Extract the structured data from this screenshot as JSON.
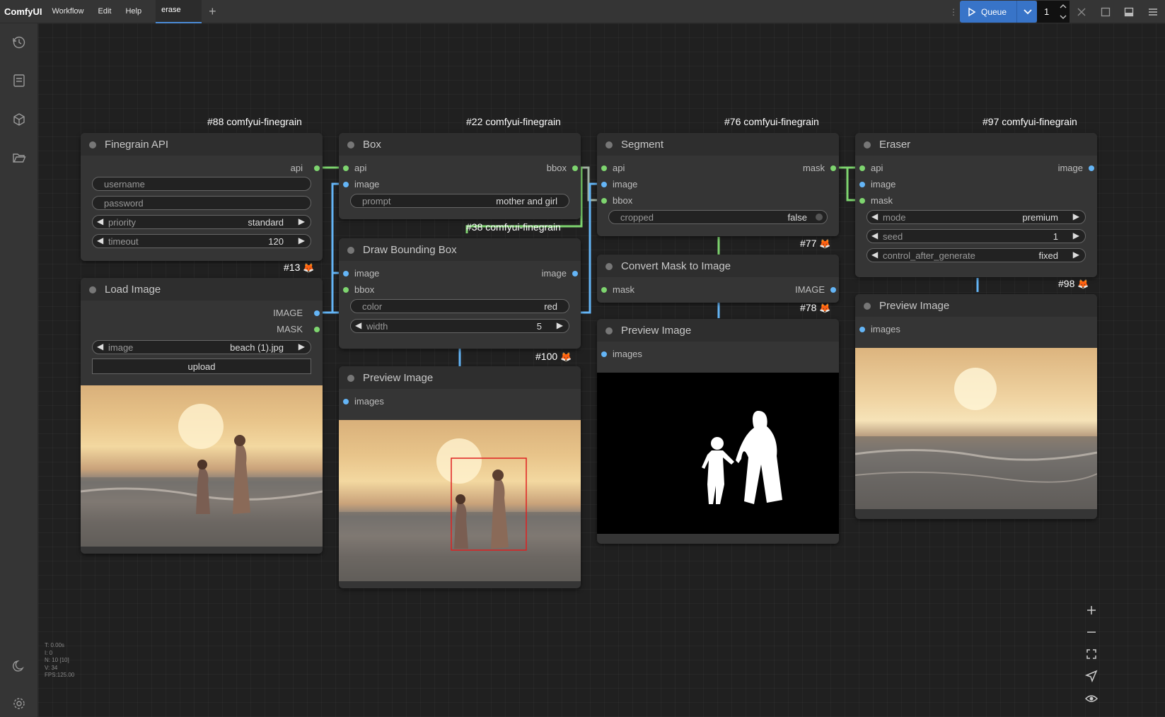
{
  "app": {
    "brand": "ComfyUI"
  },
  "menu": [
    "Workflow",
    "Edit",
    "Help"
  ],
  "tab": {
    "label": "erase",
    "add": "+"
  },
  "queue": {
    "label": "Queue",
    "count": "1"
  },
  "colors": {
    "accent": "#3874c8",
    "wire_blue": "#64b5f6",
    "wire_green": "#7ed56f"
  },
  "nodes": {
    "api": {
      "badge": "#88 comfyui-finegrain",
      "title": "Finegrain API",
      "out_api": "api",
      "username": "username",
      "password": "password",
      "priority_label": "priority",
      "priority_value": "standard",
      "timeout_label": "timeout",
      "timeout_value": "120",
      "id": "#13"
    },
    "load": {
      "title": "Load Image",
      "out_image": "IMAGE",
      "out_mask": "MASK",
      "image_label": "image",
      "image_value": "beach (1).jpg",
      "upload": "upload"
    },
    "box": {
      "badge": "#22 comfyui-finegrain",
      "title": "Box",
      "in_api": "api",
      "in_image": "image",
      "out_bbox": "bbox",
      "prompt_label": "prompt",
      "prompt_value": "mother and girl"
    },
    "draw": {
      "badge": "#38 comfyui-finegrain",
      "title": "Draw Bounding Box",
      "in_image": "image",
      "in_bbox": "bbox",
      "out_image": "image",
      "color_label": "color",
      "color_value": "red",
      "width_label": "width",
      "width_value": "5",
      "id": "#100"
    },
    "preview1": {
      "title": "Preview Image",
      "in_images": "images"
    },
    "segment": {
      "badge": "#76 comfyui-finegrain",
      "title": "Segment",
      "in_api": "api",
      "in_image": "image",
      "in_bbox": "bbox",
      "out_mask": "mask",
      "cropped_label": "cropped",
      "cropped_value": "false",
      "id": "#77"
    },
    "convert": {
      "title": "Convert Mask to Image",
      "in_mask": "mask",
      "out_image": "IMAGE",
      "id": "#78"
    },
    "preview2": {
      "title": "Preview Image",
      "in_images": "images"
    },
    "eraser": {
      "badge": "#97 comfyui-finegrain",
      "title": "Eraser",
      "in_api": "api",
      "in_image": "image",
      "in_mask": "mask",
      "out_image": "image",
      "mode_label": "mode",
      "mode_value": "premium",
      "seed_label": "seed",
      "seed_value": "1",
      "cag_label": "control_after_generate",
      "cag_value": "fixed",
      "id": "#98"
    },
    "preview3": {
      "title": "Preview Image",
      "in_images": "images"
    }
  },
  "stats": [
    "T: 0.00s",
    "I: 0",
    "N: 10 [10]",
    "V: 34",
    "FPS:125.00"
  ]
}
